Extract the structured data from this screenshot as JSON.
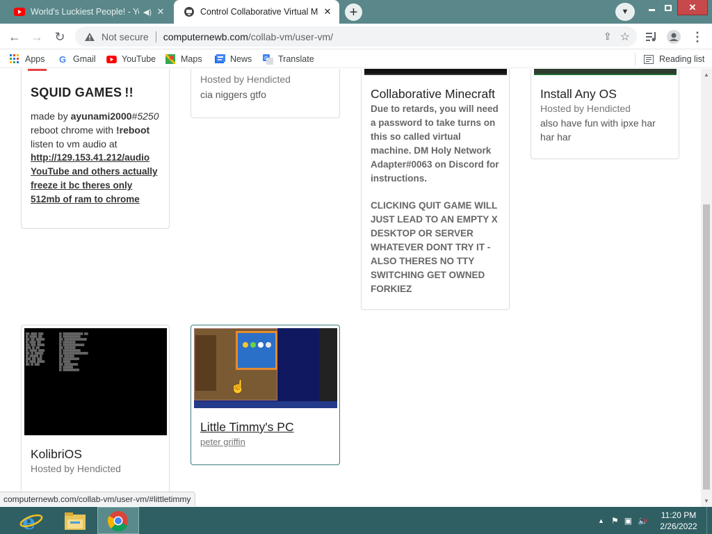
{
  "browser": {
    "tabs": [
      {
        "title": "World's Luckiest People! - Yo",
        "active": false,
        "icon": "youtube-icon",
        "audio": true
      },
      {
        "title": "Control Collaborative Virtual Ma",
        "active": true,
        "icon": "vm-icon"
      }
    ],
    "security_label": "Not secure",
    "url_host": "computernewb.com",
    "url_path": "/collab-vm/user-vm/",
    "bookmarks": [
      {
        "label": "Apps",
        "icon": "apps-grid-icon"
      },
      {
        "label": "Gmail",
        "icon": "google-icon"
      },
      {
        "label": "YouTube",
        "icon": "youtube-icon"
      },
      {
        "label": "Maps",
        "icon": "maps-icon"
      },
      {
        "label": "News",
        "icon": "news-icon"
      },
      {
        "label": "Translate",
        "icon": "translate-icon"
      }
    ],
    "reading_list": "Reading list",
    "status_url": "computernewb.com/collab-vm/user-vm/#littletimmy"
  },
  "vms": {
    "squid": {
      "title": "SQUID GAMES",
      "title_suffix": "!!",
      "made_by_prefix": "made by ",
      "made_by_user": "ayunami2000",
      "made_by_tag": "#5250",
      "reboot_prefix": "reboot chrome with ",
      "reboot_cmd": "!reboot",
      "audio_prefix": "listen to vm audio at",
      "audio_link": "http://129.153.41.212/audio",
      "warning": "YouTube and others actually freeze it bc theres only 512mb of ram to chrome"
    },
    "partial": {
      "host": "Hosted by Hendicted",
      "desc": "cia niggers gtfo"
    },
    "minecraft": {
      "title": "Collaborative Minecraft",
      "desc1": "Due to retards, you will need a password to take turns on this so called virtual machine. DM Holy Network Adapter#0063 on Discord for instructions.",
      "desc2": "CLICKING QUIT GAME WILL JUST LEAD TO AN EMPTY X DESKTOP OR SERVER WHATEVER DONT TRY IT - ALSO THERES NO TTY SWITCHING GET OWNED FORKIEZ"
    },
    "installos": {
      "title": "Install Any OS",
      "host": "Hosted by Hendicted",
      "desc": "also have fun with ipxe har har har"
    },
    "kolibri": {
      "title": "KolibriOS",
      "host": "Hosted by Hendicted"
    },
    "timmy": {
      "title": "Little Timmy's PC",
      "host": "peter griffin"
    }
  },
  "taskbar": {
    "time": "11:20 PM",
    "date": "2/26/2022",
    "apps": [
      "internet-explorer-icon",
      "file-explorer-icon",
      "chrome-icon"
    ]
  }
}
